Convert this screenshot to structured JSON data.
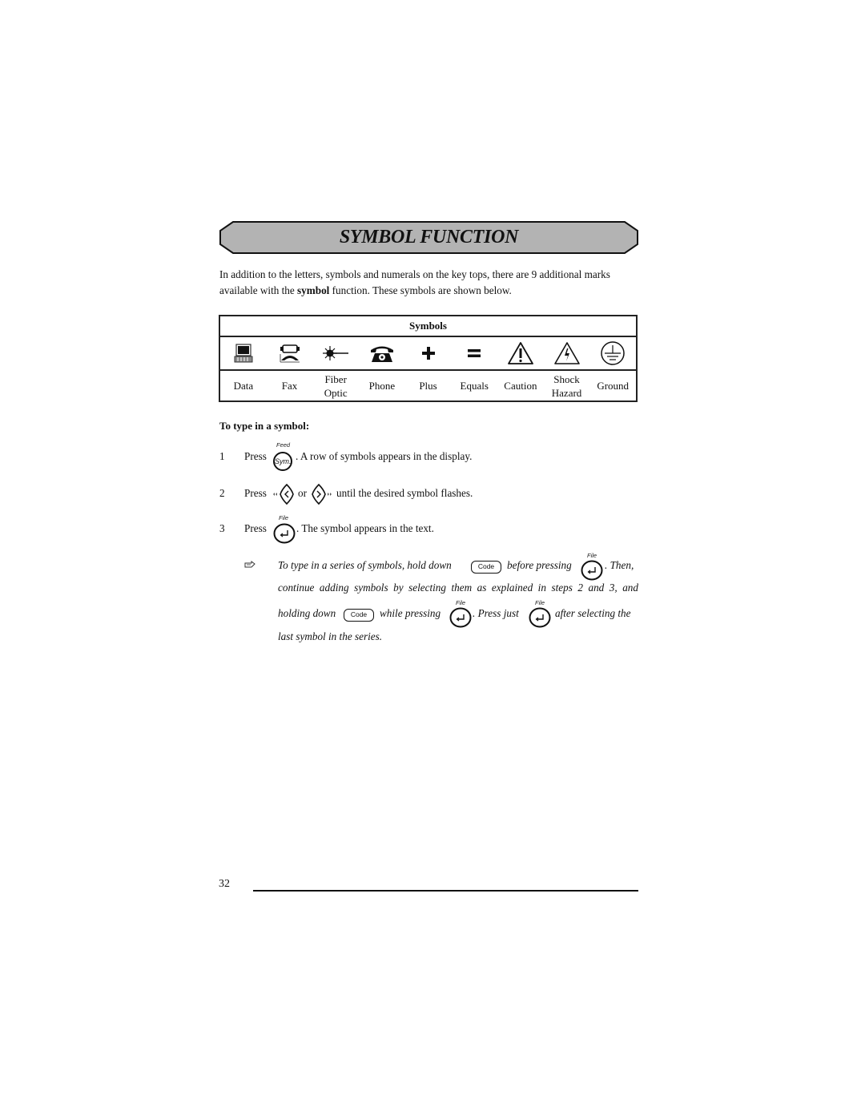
{
  "title": "SYMBOL FUNCTION",
  "intro": {
    "part1": "In addition to the letters, symbols and numerals on the key tops, there are 9 additional marks available with the ",
    "bold": "symbol",
    "part2": " function. These symbols are shown below."
  },
  "symbols_table": {
    "header": "Symbols",
    "items": [
      {
        "icon": "data-icon",
        "label_line1": "Data",
        "label_line2": ""
      },
      {
        "icon": "fax-icon",
        "label_line1": "Fax",
        "label_line2": ""
      },
      {
        "icon": "fiber-optic-icon",
        "label_line1": "Fiber",
        "label_line2": "Optic"
      },
      {
        "icon": "phone-icon",
        "label_line1": "Phone",
        "label_line2": ""
      },
      {
        "icon": "plus-icon",
        "label_line1": "Plus",
        "label_line2": ""
      },
      {
        "icon": "equals-icon",
        "label_line1": "Equals",
        "label_line2": ""
      },
      {
        "icon": "caution-icon",
        "label_line1": "Caution",
        "label_line2": ""
      },
      {
        "icon": "shock-hazard-icon",
        "label_line1": "Shock",
        "label_line2": "Hazard"
      },
      {
        "icon": "ground-icon",
        "label_line1": "Ground",
        "label_line2": ""
      }
    ]
  },
  "howto": {
    "heading": "To type in a symbol:",
    "steps": [
      {
        "num": "1",
        "press": "Press",
        "key_caption": "Feed",
        "key_label": "Sym.",
        "text": ". A row of symbols appears in the display."
      },
      {
        "num": "2",
        "press": "Press",
        "or": "or",
        "text": "until the desired symbol flashes."
      },
      {
        "num": "3",
        "press": "Press",
        "key_caption": "File",
        "text": ". The symbol appears in the text."
      }
    ],
    "note": {
      "icon": "pointing-hand-icon",
      "l1a": "To type in a series of symbols, hold down",
      "code_key": "Code",
      "l1b": "before pressing",
      "file_caption": "File",
      "l1c": ". Then,",
      "l2": "continue adding symbols by selecting them as explained in steps 2 and 3, and",
      "l3a": "holding down",
      "l3b": "while pressing",
      "l3c": ". Press just",
      "l3d": "after selecting the",
      "l4": "last symbol in the series."
    }
  },
  "footer": {
    "page_number": "32"
  }
}
